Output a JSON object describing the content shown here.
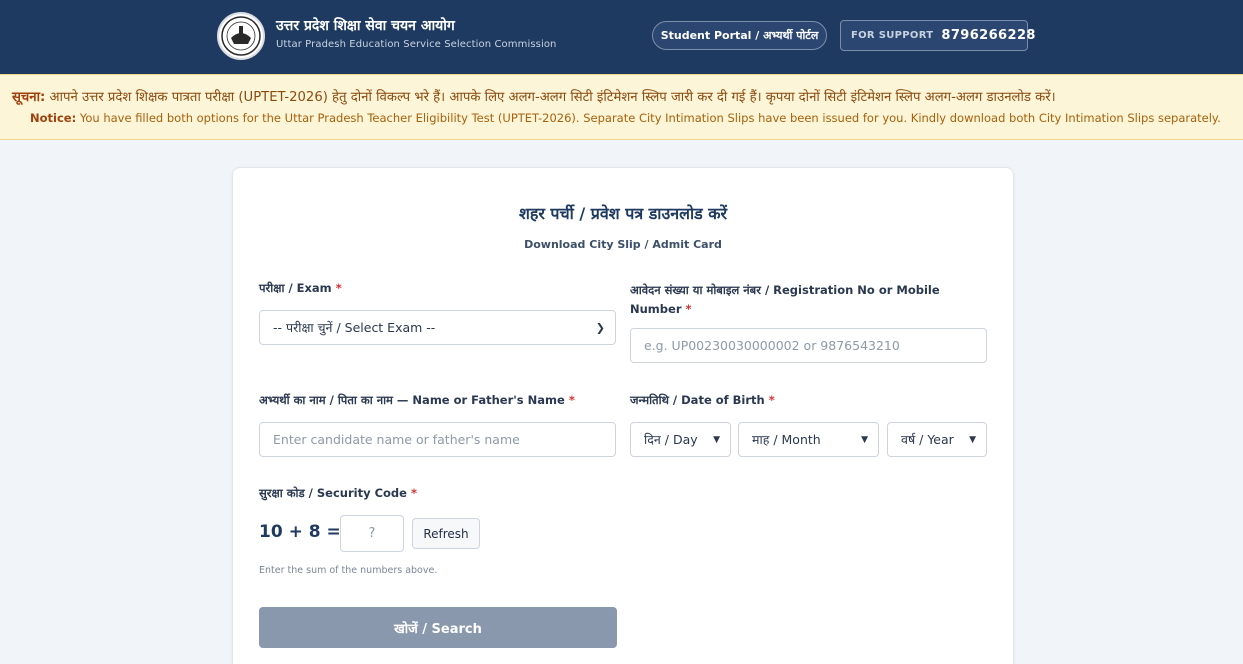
{
  "header": {
    "org_name_hi": "उत्तर प्रदेश शिक्षा सेवा चयन आयोग",
    "org_name_en": "Uttar Pradesh Education Service Selection Commission",
    "logo_icon": "up-state-emblem-icon",
    "portal_button": "Student Portal / अभ्यर्थी पोर्टल",
    "support_label": "FOR SUPPORT",
    "support_number": "8796266228"
  },
  "notice": {
    "hi_prefix": "सूचना:",
    "hi_text": "आपने उत्तर प्रदेश शिक्षक पात्रता परीक्षा (UPTET-2026) हेतु दोनों विकल्प भरे हैं। आपके लिए अलग-अलग सिटी इंटिमेशन स्लिप जारी कर दी गई हैं। कृपया दोनों सिटी इंटिमेशन स्लिप अलग-अलग डाउनलोड करें।",
    "en_prefix": "Notice:",
    "en_text": "You have filled both options for the Uttar Pradesh Teacher Eligibility Test (UPTET-2026). Separate City Intimation Slips have been issued for you. Kindly download both City Intimation Slips separately."
  },
  "form": {
    "title": "शहर पर्ची / प्रवेश पत्र डाउनलोड करें",
    "subtitle": "Download City Slip / Admit Card",
    "exam": {
      "label": "परीक्षा / Exam",
      "required": "*",
      "selected": "-- परीक्षा चुनें / Select Exam --"
    },
    "registration": {
      "label_line1": "आवेदन संख्या या मोबाइल नंबर / Registration No or Mobile",
      "label_line2": "Number",
      "required": "*",
      "placeholder": "e.g. UP00230030000002 or 9876543210"
    },
    "name": {
      "label": "अभ्यर्थी का नाम / पिता का नाम — Name or Father's Name",
      "required": "*",
      "placeholder": "Enter candidate name or father's name"
    },
    "dob": {
      "label": "जन्मतिथि / Date of Birth",
      "required": "*",
      "day": "दिन / Day",
      "month": "माह / Month",
      "year": "वर्ष / Year"
    },
    "captcha": {
      "label": "सुरक्षा कोड / Security Code",
      "required": "*",
      "expression": "10 + 8 =",
      "placeholder": "?",
      "refresh": "Refresh",
      "hint": "Enter the sum of the numbers above."
    },
    "search_button": "खोजें / Search"
  },
  "colors": {
    "header_bg": "#1f3a60",
    "notice_bg": "#fdf5d7",
    "required": "#d63131",
    "search_disabled": "#8a98ad"
  }
}
